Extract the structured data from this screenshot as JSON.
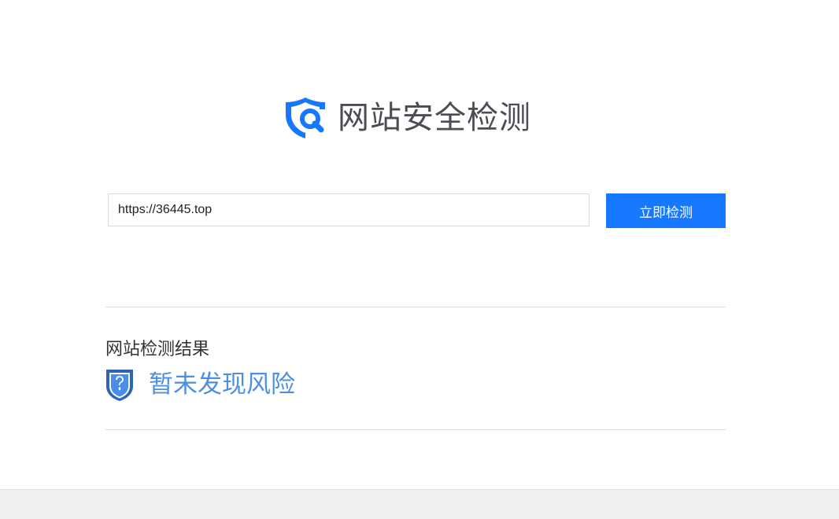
{
  "header": {
    "logo_icon": "shield-search-icon",
    "title": "网站安全检测"
  },
  "search": {
    "value": "https://36445.top",
    "placeholder": ""
  },
  "actions": {
    "check_label": "立即检测"
  },
  "result": {
    "title": "网站检测结果",
    "status_icon": "shield-question-icon",
    "status_text": "暂未发现风险"
  },
  "colors": {
    "accent": "#1677ff",
    "status": "#4d8fe0",
    "title_text": "#4a4d53",
    "footer_bg": "#efeff1"
  }
}
